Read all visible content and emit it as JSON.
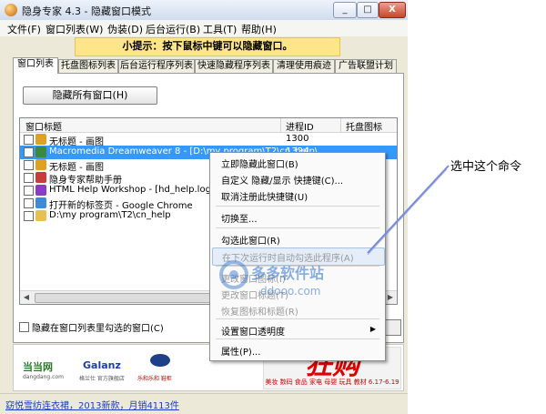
{
  "window": {
    "title": "隐身专家 4.3 - 隐藏窗口模式",
    "buttons": {
      "minimize": "_",
      "maximize": "□",
      "close": "X"
    }
  },
  "menubar": {
    "items": [
      "文件(F)",
      "窗口列表(W)",
      "伪装(D)",
      "后台运行(B)",
      "工具(T)",
      "帮助(H)"
    ]
  },
  "hint": "小提示：按下鼠标中键可以隐藏窗口。",
  "tabs": [
    "窗口列表",
    "托盘图标列表",
    "后台运行程序列表",
    "快速隐藏程序列表",
    "清理使用痕迹",
    "广告联盟计划"
  ],
  "panel": {
    "hide_all_button": "隐藏所有窗口(H)",
    "list": {
      "columns": [
        "窗口标题",
        "进程ID",
        "托盘图标"
      ],
      "rows": [
        {
          "title": "无标题 - 画图",
          "pid": "1300",
          "icon": "paint-icon",
          "icon_color": "#e0a020",
          "selected": false
        },
        {
          "title": "Macromedia Dreamweaver 8 - [D:\\my program\\T2\\cn_help\\...",
          "pid": "1324",
          "icon": "dreamweaver-icon",
          "icon_color": "#3b8a3b",
          "selected": true
        },
        {
          "title": "无标题 - 画图",
          "pid": "",
          "icon": "paint-icon",
          "icon_color": "#e0a020",
          "selected": false
        },
        {
          "title": "隐身专家帮助手册",
          "pid": "",
          "icon": "help-book-icon",
          "icon_color": "#c83c3c",
          "selected": false
        },
        {
          "title": "HTML Help Workshop - [hd_help.log]",
          "pid": "",
          "icon": "help-workshop-icon",
          "icon_color": "#8a3cc8",
          "selected": false
        },
        {
          "title": "打开新的标签页 - Google Chrome",
          "pid": "",
          "icon": "chrome-icon",
          "icon_color": "#3c8ad8",
          "selected": false
        },
        {
          "title": "D:\\my program\\T2\\cn_help",
          "pid": "",
          "icon": "folder-icon",
          "icon_color": "#e8c050",
          "selected": false
        }
      ]
    },
    "hide_checked_label": "隐藏在窗口列表里勾选的窗口(C)"
  },
  "context_menu": {
    "items": [
      {
        "label": "立即隐藏此窗口(B)",
        "disabled": false
      },
      {
        "label": "自定义 隐藏/显示 快捷键(C)...",
        "disabled": false
      },
      {
        "label": "取消注册此快捷键(U)",
        "disabled": false
      },
      {
        "label": "切换至...",
        "disabled": false
      },
      {
        "label": "勾选此窗口(R)",
        "disabled": false
      },
      {
        "label": "在下次运行时自动勾选此程序(A)",
        "disabled": true
      },
      {
        "label": "更改窗口图标(I)",
        "disabled": true
      },
      {
        "label": "更改窗口标题(T)",
        "disabled": true
      },
      {
        "label": "恢复图标和标题(R)",
        "disabled": true
      },
      {
        "label": "设置窗口透明度",
        "disabled": false,
        "submenu": true
      },
      {
        "label": "属性(P)...",
        "disabled": false
      }
    ]
  },
  "ad": {
    "logo1": "当当网",
    "logo1_sub": "dangdang.com",
    "logo2": "Galanz",
    "logo2_sub": "格兰仕 官方旗舰店",
    "logo3_sub": "乐和乐和 鞋柜",
    "promo": "狂购",
    "promo_sub": "美妆 数码 食品 家电 母婴 玩具 教材 6.17-6.19"
  },
  "status_link": "窈悦雪纺连衣裙，2013新款，月销4113件",
  "watermark": {
    "text": "多多软件站",
    "url": "ddooo.com"
  },
  "callout": "选中这个命令",
  "colors": {
    "selection": "#3399ff",
    "hint_bg": "#fde68a",
    "pointer_line": "#7a8cd8"
  }
}
